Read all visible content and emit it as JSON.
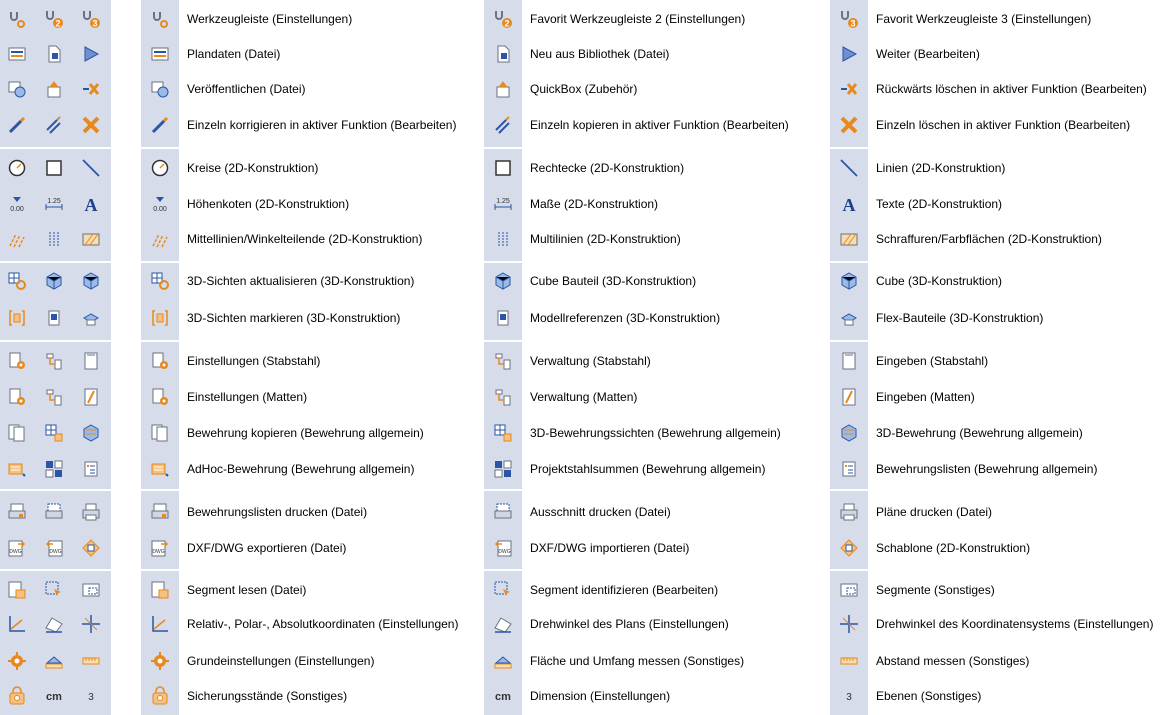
{
  "colors": {
    "strip": "#d6dce9",
    "text": "#000000",
    "accent_orange": "#e8891e",
    "accent_blue": "#2b55a5"
  },
  "rows": [
    {
      "group": 1,
      "a": {
        "icon": "toolbar-settings-icon",
        "label": "Werkzeugleiste (Einstellungen)"
      },
      "b": {
        "icon": "favorite-toolbar-2-icon",
        "badge": "2",
        "label": "Favorit Werkzeugleiste 2 (Einstellungen)"
      },
      "c": {
        "icon": "favorite-toolbar-3-icon",
        "badge": "3",
        "label": "Favorit Werkzeugleiste 3 (Einstellungen)"
      }
    },
    {
      "group": 1,
      "a": {
        "icon": "plan-data-icon",
        "label": "Plandaten (Datei)"
      },
      "b": {
        "icon": "new-from-library-icon",
        "label": "Neu aus Bibliothek (Datei)"
      },
      "c": {
        "icon": "play-next-icon",
        "label": "Weiter (Bearbeiten)"
      }
    },
    {
      "group": 1,
      "a": {
        "icon": "publish-icon",
        "label": "Veröffentlichen (Datei)"
      },
      "b": {
        "icon": "quickbox-icon",
        "label": "QuickBox (Zubehör)"
      },
      "c": {
        "icon": "delete-backwards-icon",
        "label": "Rückwärts löschen in aktiver Funktion (Bearbeiten)"
      }
    },
    {
      "group": 1,
      "a": {
        "icon": "correct-single-icon",
        "label": "Einzeln korrigieren in aktiver Funktion (Bearbeiten)"
      },
      "b": {
        "icon": "copy-single-icon",
        "label": "Einzeln kopieren in aktiver Funktion (Bearbeiten)"
      },
      "c": {
        "icon": "delete-single-icon",
        "label": "Einzeln löschen in aktiver Funktion (Bearbeiten)"
      }
    },
    {
      "group": 2,
      "a": {
        "icon": "circle-icon",
        "label": "Kreise (2D-Konstruktion)"
      },
      "b": {
        "icon": "rectangle-icon",
        "label": "Rechtecke (2D-Konstruktion)"
      },
      "c": {
        "icon": "line-icon",
        "label": "Linien (2D-Konstruktion)"
      }
    },
    {
      "group": 2,
      "a": {
        "icon": "elevation-point-icon",
        "label": "Höhenkoten (2D-Konstruktion)"
      },
      "b": {
        "icon": "dimension-icon",
        "label": "Maße (2D-Konstruktion)"
      },
      "c": {
        "icon": "text-icon",
        "label": "Texte (2D-Konstruktion)"
      }
    },
    {
      "group": 2,
      "a": {
        "icon": "center-lines-icon",
        "label": "Mittellinien/Winkelteilende (2D-Konstruktion)"
      },
      "b": {
        "icon": "multilines-icon",
        "label": "Multilinien (2D-Konstruktion)"
      },
      "c": {
        "icon": "hatching-icon",
        "label": "Schraffuren/Farbflächen (2D-Konstruktion)"
      }
    },
    {
      "group": 3,
      "a": {
        "icon": "update-3d-views-icon",
        "label": "3D-Sichten aktualisieren (3D-Konstruktion)"
      },
      "b": {
        "icon": "cube-part-icon",
        "label": "Cube Bauteil (3D-Konstruktion)"
      },
      "c": {
        "icon": "cube-icon",
        "label": "Cube (3D-Konstruktion)"
      }
    },
    {
      "group": 3,
      "a": {
        "icon": "mark-3d-views-icon",
        "label": "3D-Sichten markieren (3D-Konstruktion)"
      },
      "b": {
        "icon": "model-references-icon",
        "label": "Modellreferenzen (3D-Konstruktion)"
      },
      "c": {
        "icon": "flex-parts-icon",
        "label": "Flex-Bauteile (3D-Konstruktion)"
      }
    },
    {
      "group": 4,
      "a": {
        "icon": "rebar-settings-icon",
        "label": "Einstellungen (Stabstahl)"
      },
      "b": {
        "icon": "rebar-management-icon",
        "label": "Verwaltung (Stabstahl)"
      },
      "c": {
        "icon": "rebar-input-icon",
        "label": "Eingeben (Stabstahl)"
      }
    },
    {
      "group": 4,
      "a": {
        "icon": "mesh-settings-icon",
        "label": "Einstellungen (Matten)"
      },
      "b": {
        "icon": "mesh-management-icon",
        "label": "Verwaltung (Matten)"
      },
      "c": {
        "icon": "mesh-input-icon",
        "label": "Eingeben (Matten)"
      }
    },
    {
      "group": 4,
      "a": {
        "icon": "copy-reinforcement-icon",
        "label": "Bewehrung kopieren (Bewehrung allgemein)"
      },
      "b": {
        "icon": "3d-reinforcement-views-icon",
        "label": "3D-Bewehrungssichten (Bewehrung allgemein)"
      },
      "c": {
        "icon": "3d-reinforcement-icon",
        "label": "3D-Bewehrung (Bewehrung allgemein)"
      }
    },
    {
      "group": 4,
      "a": {
        "icon": "adhoc-reinforcement-icon",
        "label": "AdHoc-Bewehrung (Bewehrung allgemein)"
      },
      "b": {
        "icon": "project-steel-totals-icon",
        "label": "Projektstahlsummen (Bewehrung allgemein)"
      },
      "c": {
        "icon": "reinforcement-lists-icon",
        "label": "Bewehrungslisten (Bewehrung allgemein)"
      }
    },
    {
      "group": 5,
      "a": {
        "icon": "print-reinforcement-lists-icon",
        "label": "Bewehrungslisten drucken (Datei)"
      },
      "b": {
        "icon": "print-section-icon",
        "label": "Ausschnitt drucken (Datei)"
      },
      "c": {
        "icon": "printer-icon",
        "label": "Pläne drucken (Datei)"
      }
    },
    {
      "group": 5,
      "a": {
        "icon": "export-dwg-icon",
        "label": "DXF/DWG exportieren (Datei)"
      },
      "b": {
        "icon": "import-dwg-icon",
        "label": "DXF/DWG importieren (Datei)"
      },
      "c": {
        "icon": "template-icon",
        "label": "Schablone (2D-Konstruktion)"
      }
    },
    {
      "group": 6,
      "a": {
        "icon": "read-segment-icon",
        "label": "Segment lesen (Datei)"
      },
      "b": {
        "icon": "identify-segment-icon",
        "label": "Segment identifizieren (Bearbeiten)"
      },
      "c": {
        "icon": "segments-icon",
        "label": "Segmente (Sonstiges)"
      }
    },
    {
      "group": 6,
      "a": {
        "icon": "coordinates-icon",
        "label": "Relativ-, Polar-, Absolutkoordinaten (Einstellungen)"
      },
      "b": {
        "icon": "plan-rotation-icon",
        "label": "Drehwinkel des Plans (Einstellungen)"
      },
      "c": {
        "icon": "coordinate-system-rotation-icon",
        "label": "Drehwinkel des Koordinatensystems (Einstellungen)"
      }
    },
    {
      "group": 6,
      "a": {
        "icon": "basic-settings-icon",
        "label": "Grundeinstellungen (Einstellungen)"
      },
      "b": {
        "icon": "measure-area-icon",
        "label": "Fläche und Umfang messen (Sonstiges)"
      },
      "c": {
        "icon": "measure-distance-icon",
        "label": "Abstand messen (Sonstiges)"
      }
    },
    {
      "group": 6,
      "a": {
        "icon": "backup-states-icon",
        "label": "Sicherungsstände (Sonstiges)"
      },
      "b": {
        "icon": "unit-cm-icon",
        "text": "cm",
        "label": "Dimension (Einstellungen)"
      },
      "c": {
        "icon": "layers-icon",
        "text": "3",
        "label": "Ebenen (Sonstiges)"
      }
    }
  ]
}
